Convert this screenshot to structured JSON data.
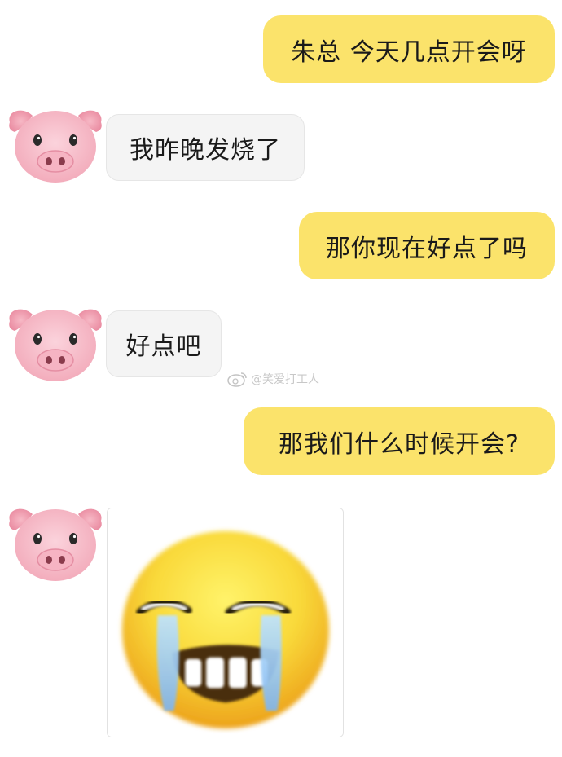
{
  "chat": {
    "messages": [
      {
        "from": "me",
        "text": "朱总 今天几点开会呀"
      },
      {
        "from": "them",
        "avatar": "pig-face-icon",
        "text": "我昨晚发烧了"
      },
      {
        "from": "me",
        "text": "那你现在好点了吗"
      },
      {
        "from": "them",
        "avatar": "pig-face-icon",
        "text": "好点吧"
      },
      {
        "from": "me",
        "text": "那我们什么时候开会?"
      },
      {
        "from": "them",
        "avatar": "pig-face-icon",
        "sticker": "crying-laughing-emoji-sticker"
      }
    ]
  },
  "watermark": {
    "text": "@笑爱打工人",
    "icon": "weibo-icon"
  },
  "colors": {
    "my_bubble": "#fbe36b",
    "their_bubble": "#f4f4f4",
    "background": "#ffffff"
  }
}
